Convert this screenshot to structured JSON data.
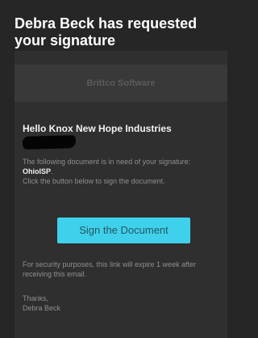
{
  "header": {
    "title": "Debra Beck has requested your signature"
  },
  "email": {
    "brand_name": "Brittco Software",
    "greeting": "Hello Knox New Hope Industries",
    "intro_prefix": "The following document is in need of your signature: ",
    "document_name": "OhioISP",
    "intro_suffix": ".",
    "instruction": "Click the button below to sign the document.",
    "sign_button_label": "Sign the Document",
    "security_note": "For security purposes, this link will expire 1 week after receiving this email.",
    "signoff": "Thanks,",
    "sender_name": "Debra Beck"
  },
  "colors": {
    "background": "#262626",
    "card": "#2f2f2f",
    "brand_bar": "#393939",
    "button": "#3fd0ec",
    "button_text": "#26575f",
    "muted_text": "#8f8f8f"
  }
}
